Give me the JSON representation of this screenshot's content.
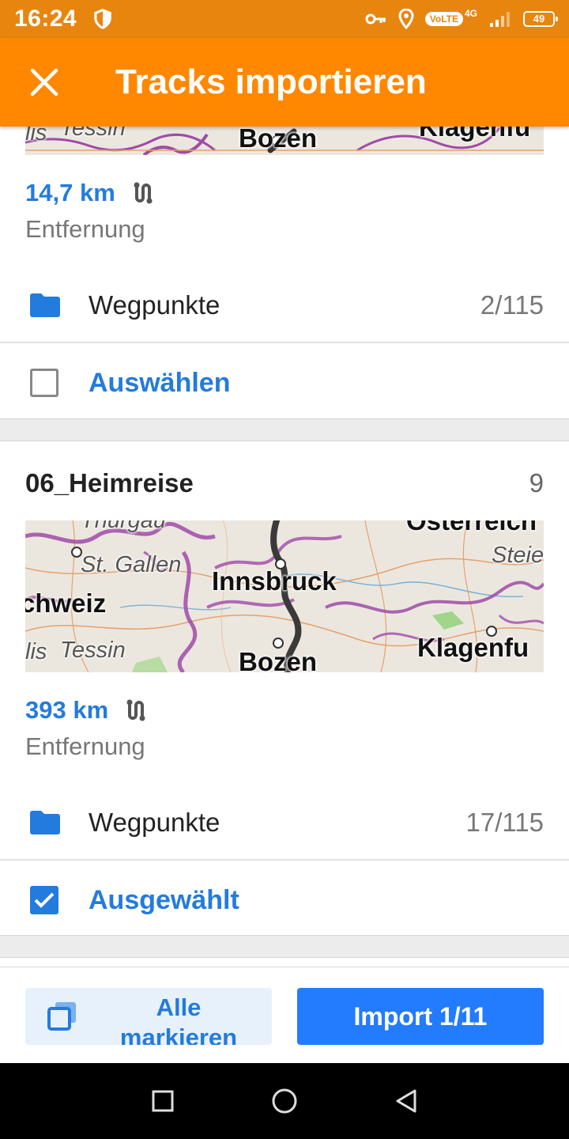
{
  "status_bar": {
    "time": "16:24",
    "volte": "VoLTE",
    "network": "4G",
    "battery": "49"
  },
  "app_bar": {
    "title": "Tracks importieren",
    "close_icon": "close-icon"
  },
  "tracks": [
    {
      "map_labels": {
        "city_a": "Bozen",
        "city_b": "Klagenfu",
        "region_a": "Tessin",
        "region_b": "lis"
      },
      "distance": "14,7 km",
      "distance_label": "Entfernung",
      "waypoints_label": "Wegpunkte",
      "waypoints_count": "2/115",
      "select_label": "Auswählen",
      "selected": false
    },
    {
      "title": "06_Heimreise",
      "number": "9",
      "map_labels": {
        "city_innsbruck": "Innsbruck",
        "city_bozen": "Bozen",
        "city_klagenfurt": "Klagenfu",
        "region_st_gallen": "St. Gallen",
        "region_schweiz": "chweiz",
        "region_tessin": "Tessin",
        "region_lis": "lis",
        "region_steier": "Steie",
        "region_oesterreich": "Österreich",
        "region_thurgau": "Thurgau"
      },
      "distance": "393 km",
      "distance_label": "Entfernung",
      "waypoints_label": "Wegpunkte",
      "waypoints_count": "17/115",
      "select_label": "Ausgewählt",
      "selected": true
    }
  ],
  "bottom_bar": {
    "select_all_label": "Alle markieren",
    "import_label": "Import 1/11"
  },
  "colors": {
    "status_bar": "#e8850f",
    "app_bar": "#ff8800",
    "accent_blue": "#237bde",
    "import_button": "#237bfd"
  }
}
